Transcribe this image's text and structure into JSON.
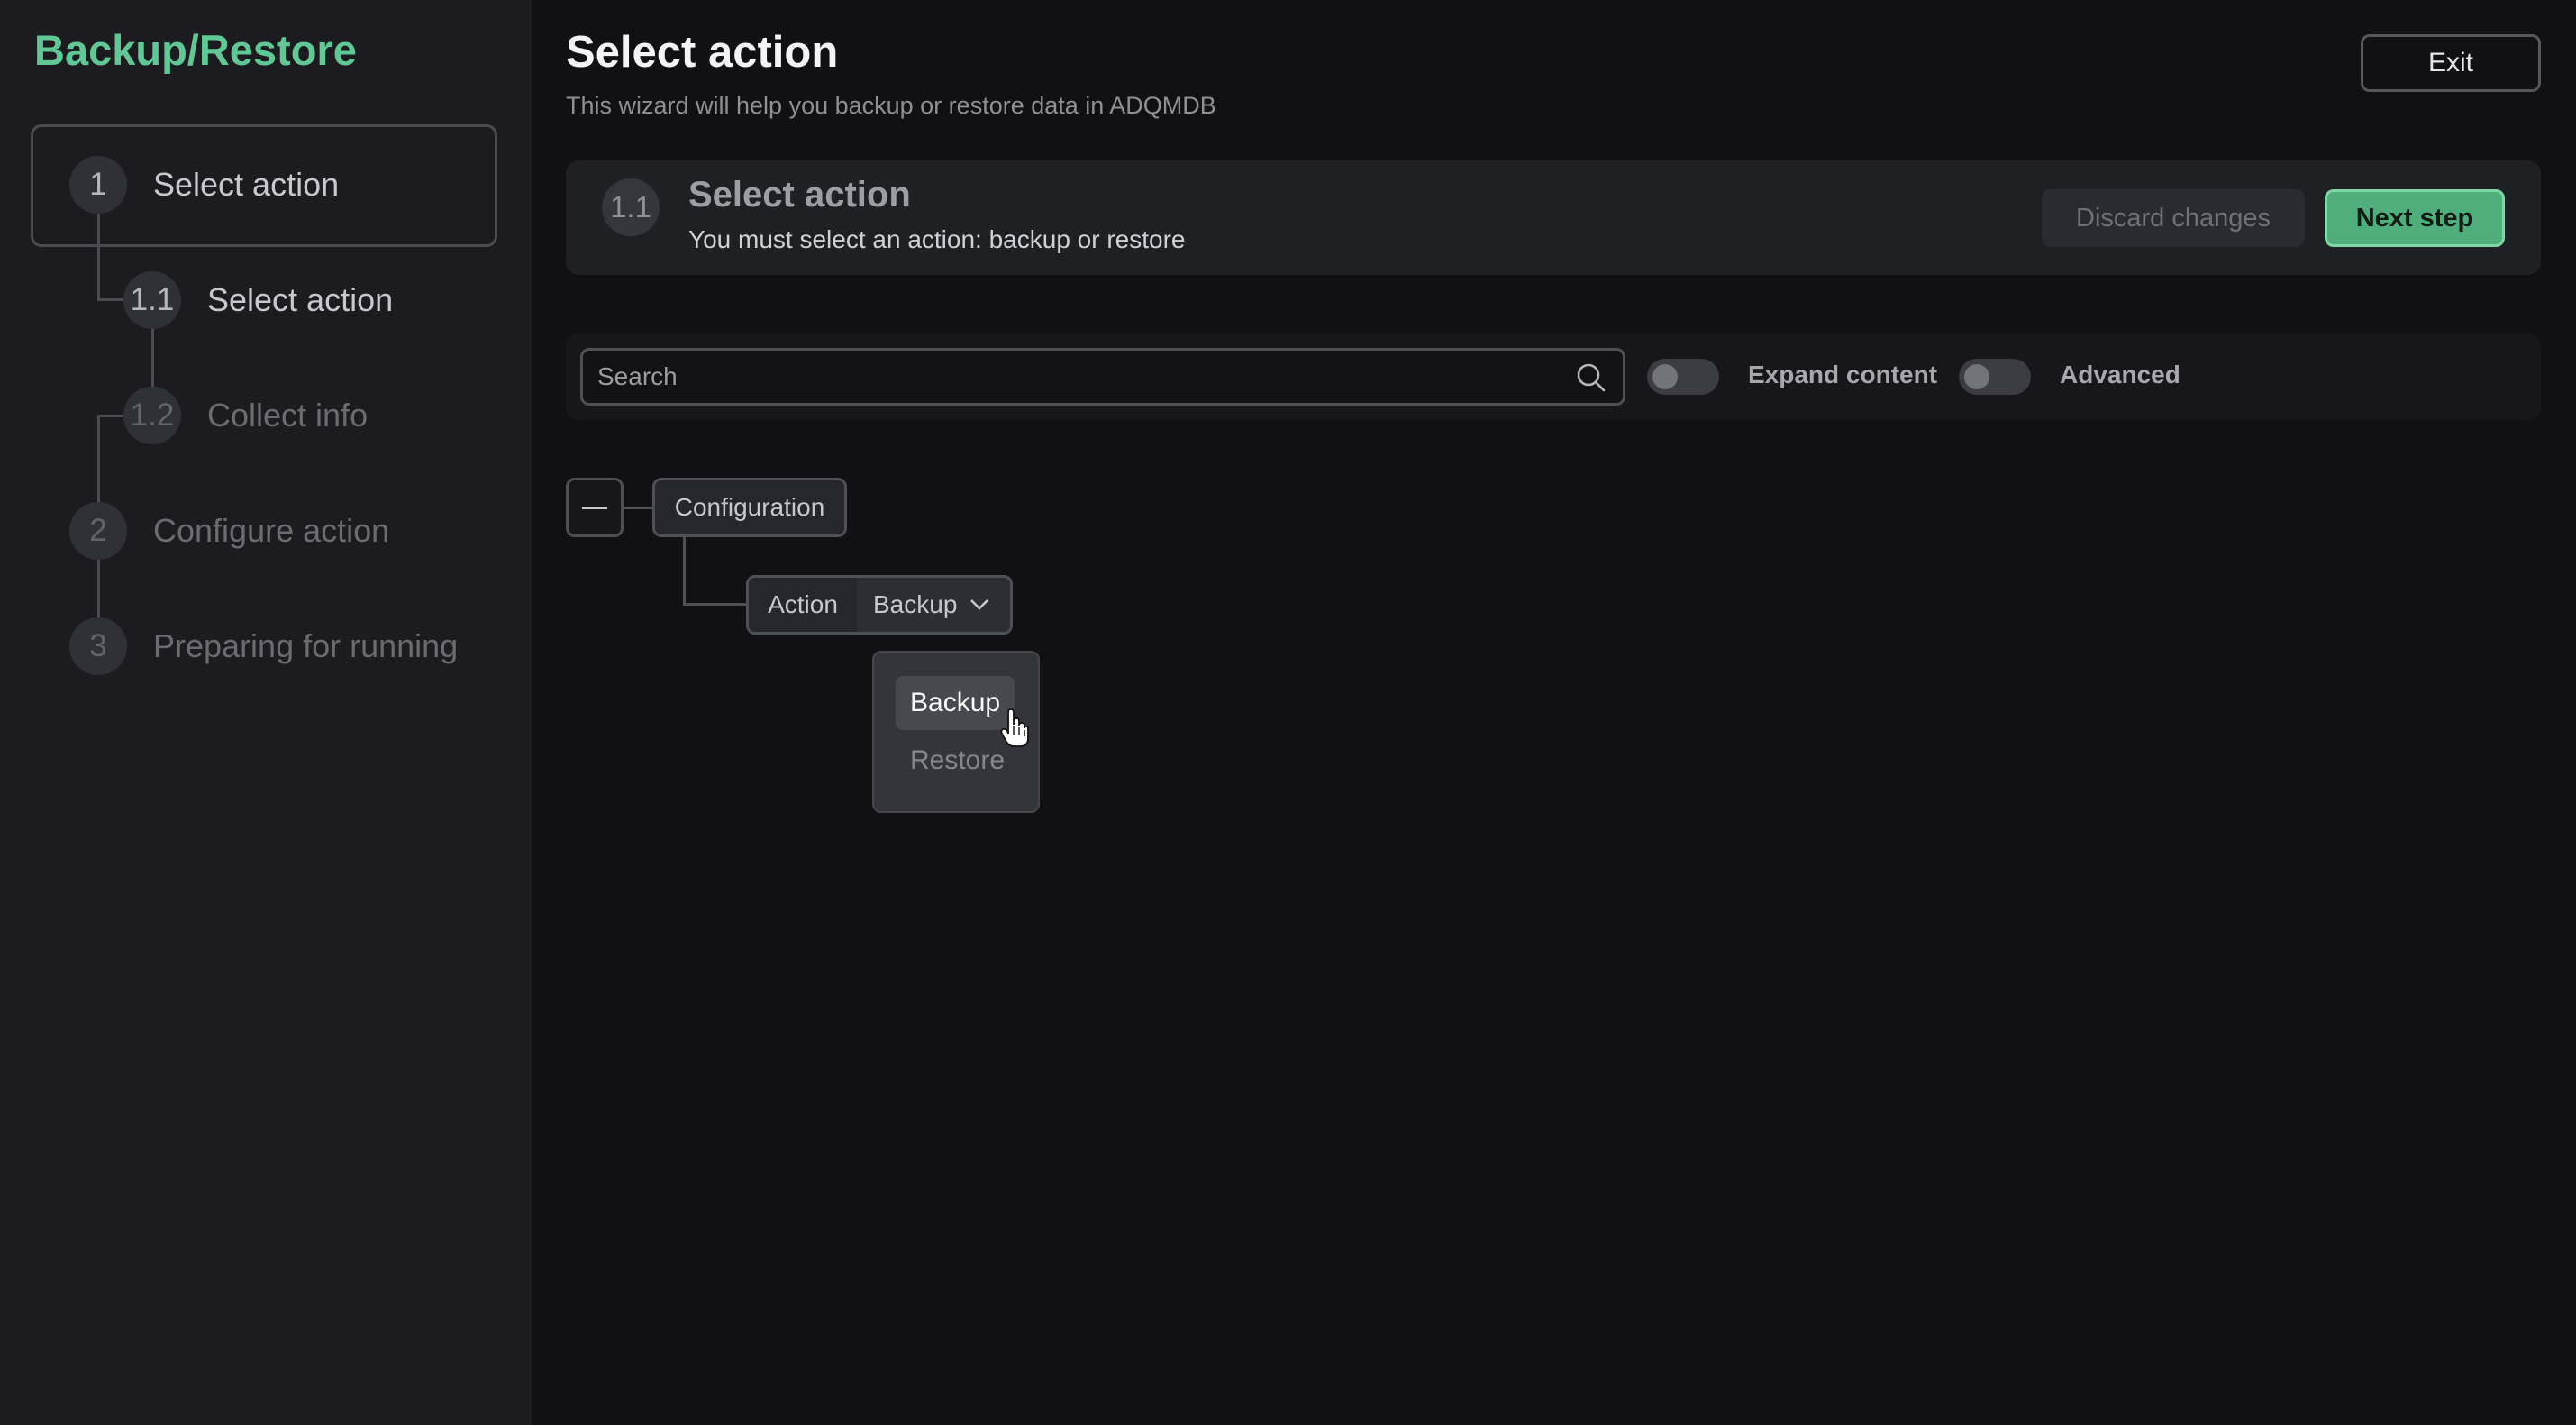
{
  "sidebar": {
    "brand": "Backup/Restore",
    "steps": [
      {
        "number": "1",
        "label": "Select action"
      },
      {
        "number": "1.1",
        "label": "Select action"
      },
      {
        "number": "1.2",
        "label": "Collect info"
      },
      {
        "number": "2",
        "label": "Configure action"
      },
      {
        "number": "3",
        "label": "Preparing for running"
      }
    ]
  },
  "header": {
    "title": "Select action",
    "subtitle": "This wizard will help you backup or restore data in ADQMDB",
    "exit_label": "Exit"
  },
  "step_card": {
    "number": "1.1",
    "title": "Select action",
    "subtitle": "You must select an action: backup or restore",
    "discard_label": "Discard changes",
    "next_label": "Next step"
  },
  "toolbar": {
    "search_placeholder": "Search",
    "search_value": "",
    "expand_label": "Expand content",
    "expand_on": false,
    "advanced_label": "Advanced",
    "advanced_on": false
  },
  "tree": {
    "root_label": "Configuration",
    "action_key": "Action",
    "action_value": "Backup",
    "options": [
      "Backup",
      "Restore"
    ]
  },
  "colors": {
    "accent": "#5fc894",
    "primary_button": "#4fae7c",
    "background": "#111114",
    "sidebar": "#1c1c20"
  }
}
